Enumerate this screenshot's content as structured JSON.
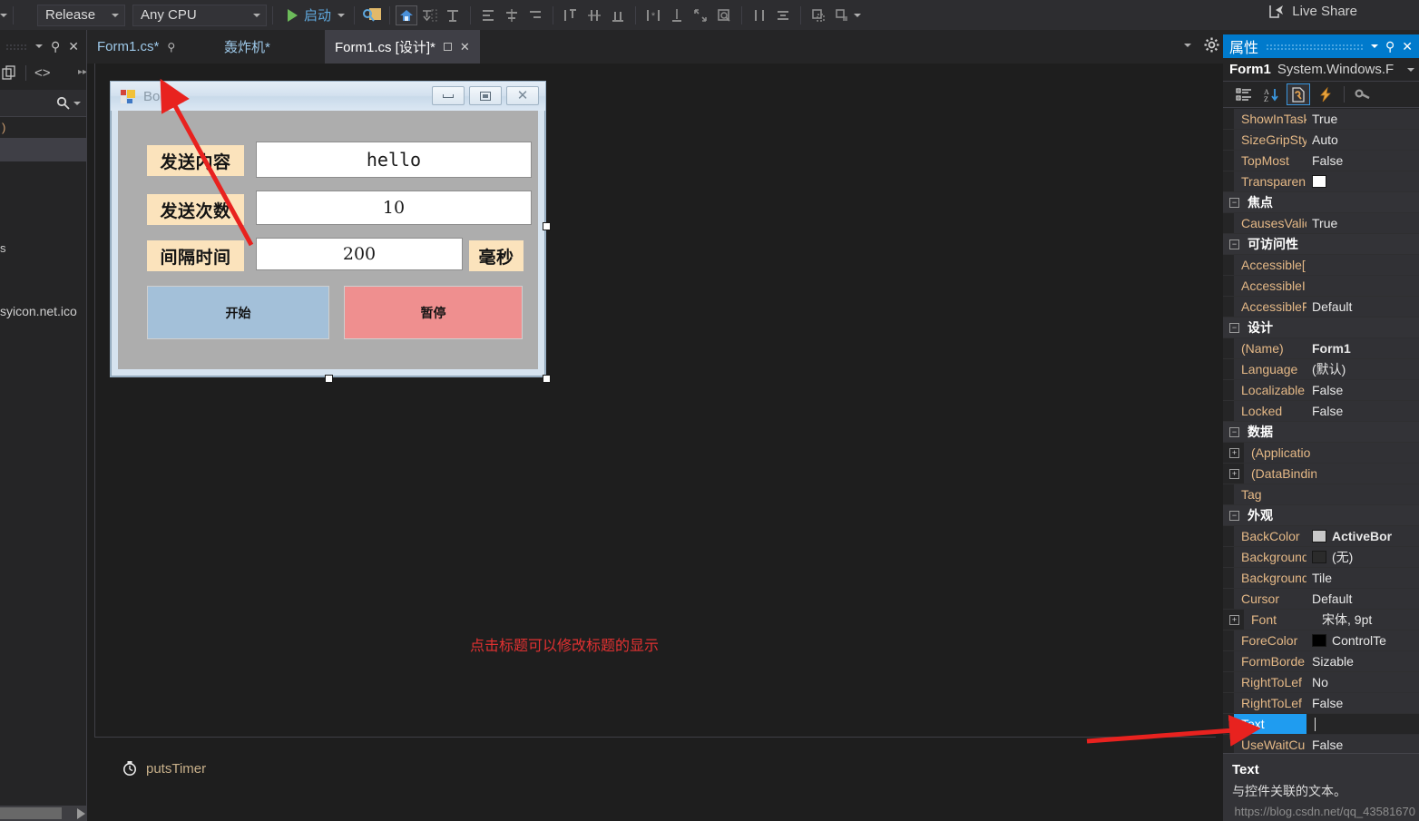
{
  "toolbar": {
    "configuration": "Release",
    "platform": "Any CPU",
    "run_label": "启动",
    "live_share": "Live Share"
  },
  "tabs": [
    {
      "label": "Form1.cs*",
      "state": "inactive"
    },
    {
      "label": "轰炸机*",
      "state": "inactive"
    },
    {
      "label": "Form1.cs [设计]*",
      "state": "active"
    }
  ],
  "left_dock": {
    "item_a": ")",
    "item_b": "s",
    "item_c": "syicon.net.ico"
  },
  "designer": {
    "form": {
      "title": "Bomb",
      "rows": [
        {
          "label": "发送内容",
          "value": "hello"
        },
        {
          "label": "发送次数",
          "value": "10"
        },
        {
          "label": "间隔时间",
          "value": "200",
          "suffix": "毫秒"
        }
      ],
      "buttons": [
        {
          "label": "开始",
          "kind": "start"
        },
        {
          "label": "暂停",
          "kind": "pause"
        }
      ]
    },
    "note": "点击标题可以修改标题的显示",
    "component_tray": {
      "name": "putsTimer"
    }
  },
  "properties": {
    "panel_title": "属性",
    "object_name": "Form1",
    "object_type": "System.Windows.F",
    "rows": [
      {
        "type": "prop",
        "name": "ShowInTask",
        "value": "True"
      },
      {
        "type": "prop",
        "name": "SizeGripSty",
        "value": "Auto"
      },
      {
        "type": "prop",
        "name": "TopMost",
        "value": "False"
      },
      {
        "type": "prop",
        "name": "Transparen",
        "value": "",
        "swatch": "#ffffff"
      },
      {
        "type": "cat",
        "name": "焦点",
        "expander": "−"
      },
      {
        "type": "prop",
        "name": "CausesValic",
        "value": "True"
      },
      {
        "type": "cat",
        "name": "可访问性",
        "expander": "−"
      },
      {
        "type": "prop",
        "name": "Accessible[",
        "value": ""
      },
      {
        "type": "prop",
        "name": "AccessibleI",
        "value": ""
      },
      {
        "type": "prop",
        "name": "AccessibleF",
        "value": "Default"
      },
      {
        "type": "cat",
        "name": "设计",
        "expander": "−"
      },
      {
        "type": "prop",
        "name": "(Name)",
        "value": "Form1",
        "bold": true
      },
      {
        "type": "prop",
        "name": "Language",
        "value": "(默认)"
      },
      {
        "type": "prop",
        "name": "Localizable",
        "value": "False"
      },
      {
        "type": "prop",
        "name": "Locked",
        "value": "False"
      },
      {
        "type": "cat",
        "name": "数据",
        "expander": "−"
      },
      {
        "type": "prop",
        "name": "(Applicatio",
        "value": "",
        "expander": "+"
      },
      {
        "type": "prop",
        "name": "(DataBindin",
        "value": "",
        "expander": "+"
      },
      {
        "type": "prop",
        "name": "Tag",
        "value": ""
      },
      {
        "type": "cat",
        "name": "外观",
        "expander": "−"
      },
      {
        "type": "prop",
        "name": "BackColor",
        "value": "ActiveBor",
        "swatch": "#c8c8c8",
        "bold": true
      },
      {
        "type": "prop",
        "name": "Backgroundc",
        "value": "(无)",
        "swatch": "#2b2b2b"
      },
      {
        "type": "prop",
        "name": "Backgroundc",
        "value": "Tile"
      },
      {
        "type": "prop",
        "name": "Cursor",
        "value": "Default"
      },
      {
        "type": "prop",
        "name": "Font",
        "value": "宋体, 9pt",
        "expander": "+"
      },
      {
        "type": "prop",
        "name": "ForeColor",
        "value": "ControlTe",
        "swatch": "#000000"
      },
      {
        "type": "prop",
        "name": "FormBorde",
        "value": "Sizable"
      },
      {
        "type": "prop",
        "name": "RightToLef",
        "value": "No"
      },
      {
        "type": "prop",
        "name": "RightToLef",
        "value": "False"
      },
      {
        "type": "prop",
        "name": "Text",
        "value": "",
        "selected": true
      },
      {
        "type": "prop",
        "name": "UseWaitCu",
        "value": "False"
      }
    ],
    "description": {
      "title": "Text",
      "body": "与控件关联的文本。"
    }
  },
  "watermark": "https://blog.csdn.net/qq_43581670"
}
